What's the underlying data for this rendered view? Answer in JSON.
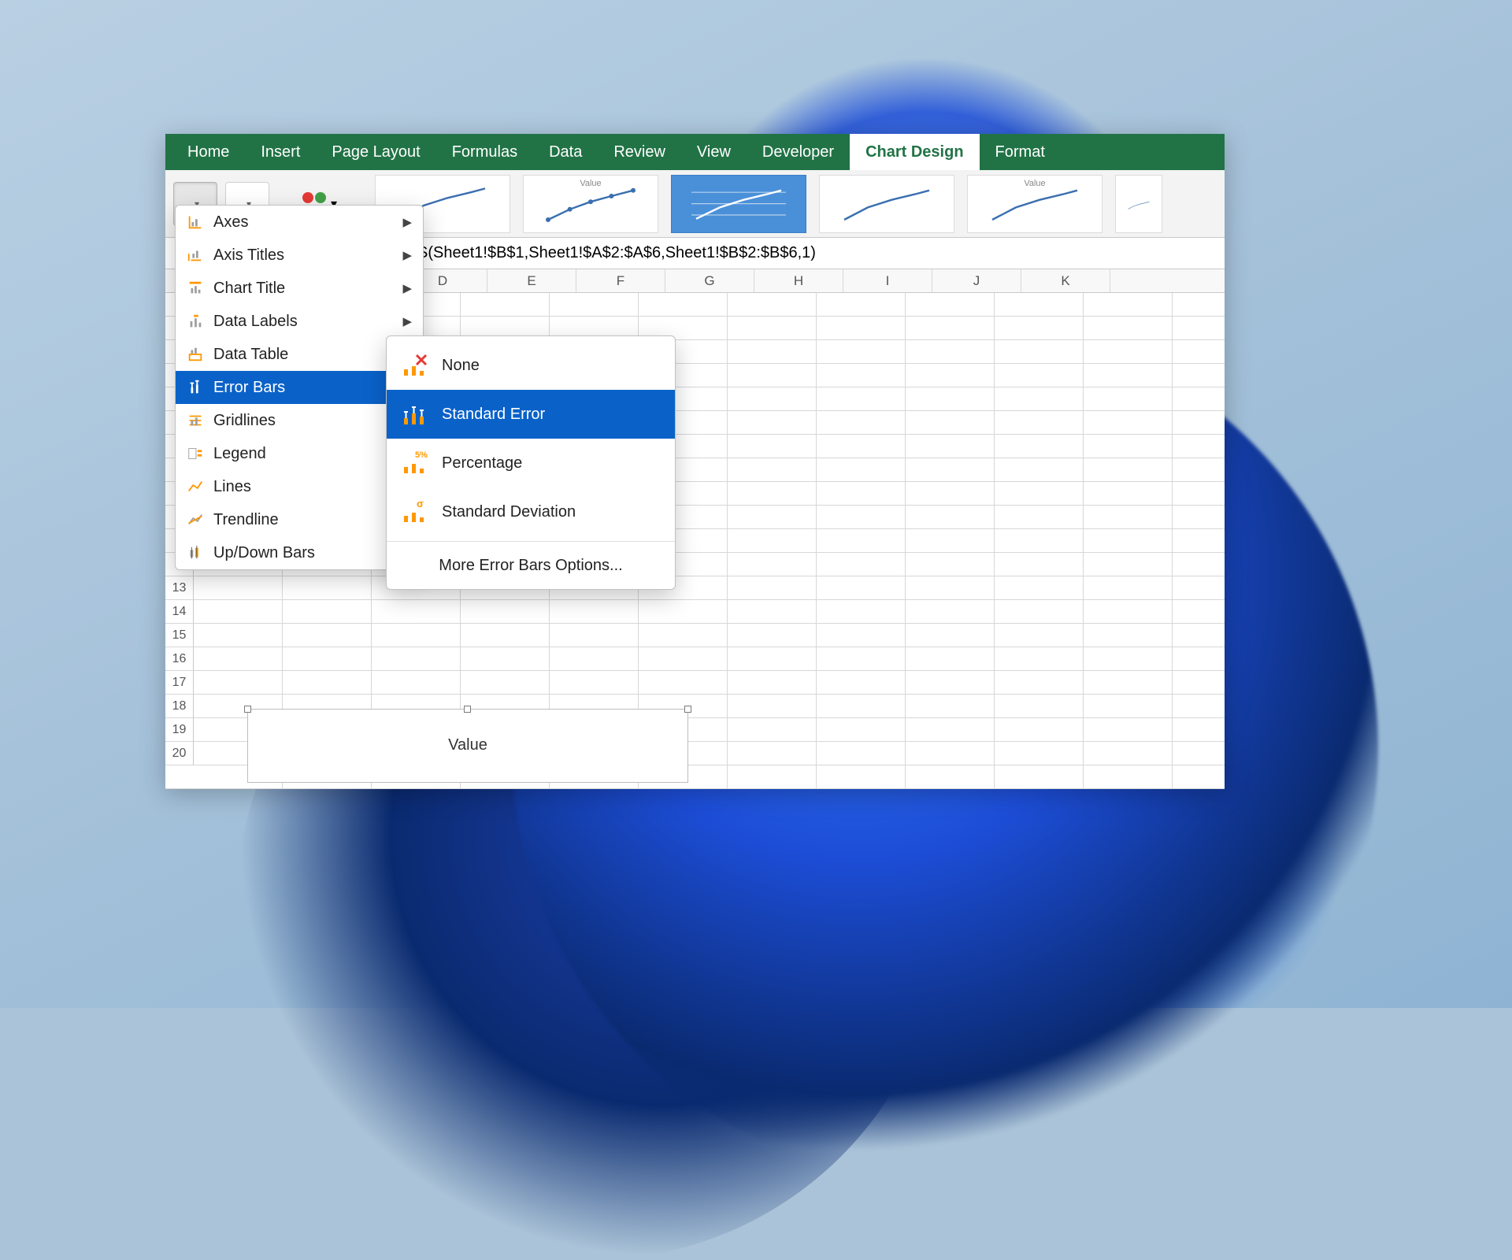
{
  "ribbon": {
    "tabs": [
      "Home",
      "Insert",
      "Page Layout",
      "Formulas",
      "Data",
      "Review",
      "View",
      "Developer",
      "Chart Design",
      "Format"
    ],
    "active_tab": "Chart Design",
    "style_thumb_title": "Value"
  },
  "formula_bar": {
    "visible_text": "SERIES(Sheet1!$B$1,Sheet1!$A$2:$A$6,Sheet1!$B$2:$B$6,1)"
  },
  "columns": [
    "D",
    "E",
    "F",
    "G",
    "H",
    "I",
    "J",
    "K"
  ],
  "rows_visible": [
    "13",
    "14",
    "15",
    "16",
    "17",
    "18",
    "19",
    "20"
  ],
  "add_element_menu": {
    "items": [
      {
        "label": "Axes"
      },
      {
        "label": "Axis Titles"
      },
      {
        "label": "Chart Title"
      },
      {
        "label": "Data Labels"
      },
      {
        "label": "Data Table"
      },
      {
        "label": "Error Bars"
      },
      {
        "label": "Gridlines"
      },
      {
        "label": "Legend"
      },
      {
        "label": "Lines"
      },
      {
        "label": "Trendline"
      },
      {
        "label": "Up/Down Bars"
      }
    ],
    "hovered_index": 5
  },
  "error_bars_submenu": {
    "items": [
      {
        "label": "None"
      },
      {
        "label": "Standard Error"
      },
      {
        "label": "Percentage"
      },
      {
        "label": "Standard Deviation"
      }
    ],
    "hovered_index": 1,
    "more": "More Error Bars Options..."
  },
  "embedded_chart": {
    "title": "Value"
  }
}
